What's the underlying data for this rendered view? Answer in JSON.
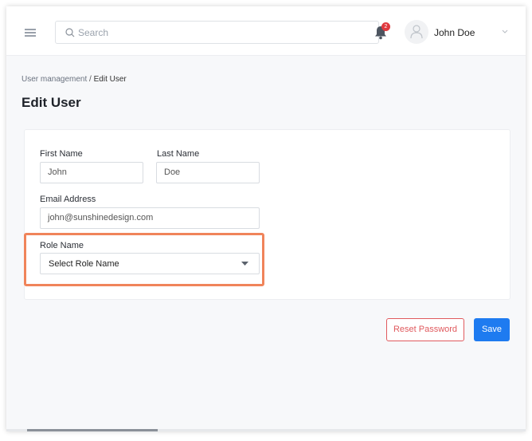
{
  "header": {
    "search_placeholder": "Search",
    "notification_count": "2",
    "user_name": "John Doe"
  },
  "breadcrumb": {
    "parent": "User management",
    "separator": " / ",
    "current": "Edit User"
  },
  "page_title": "Edit User",
  "form": {
    "first_name_label": "First Name",
    "first_name_value": "John",
    "last_name_label": "Last Name",
    "last_name_value": "Doe",
    "email_label": "Email Address",
    "email_value": "john@sunshinedesign.com",
    "role_label": "Role Name",
    "role_placeholder": "Select Role Name"
  },
  "actions": {
    "reset_label": "Reset Password",
    "save_label": "Save"
  },
  "colors": {
    "primary": "#1e7bf0",
    "danger": "#e05a5e",
    "highlight": "#f0845a",
    "badge": "#e0393e"
  },
  "icons": [
    "menu-icon",
    "search-icon",
    "bell-icon",
    "user-icon",
    "chevron-down-icon",
    "caret-down-icon"
  ]
}
